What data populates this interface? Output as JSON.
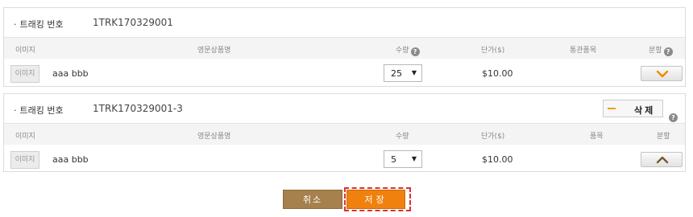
{
  "tracking_blocks": [
    {
      "label": "트래킹 번호",
      "bullet": "·",
      "number": "1TRK170329001",
      "columns": {
        "image": "이미지",
        "name": "영문상품명",
        "qty": "수량",
        "price": "단가($)",
        "category": "통관품목",
        "split": "분할"
      },
      "item": {
        "image_placeholder": "이미지",
        "name": "aaa bbb",
        "qty": "25",
        "price": "$10.00"
      },
      "split_icon": "chevron-down-icon"
    },
    {
      "label": "트래킹 번호",
      "bullet": "·",
      "number": "1TRK170329001-3",
      "delete_label": "삭제",
      "columns": {
        "image": "이미지",
        "name": "영문상품명",
        "qty": "수량",
        "price": "단가($)",
        "category": "품목",
        "split": "분할"
      },
      "item": {
        "image_placeholder": "이미지",
        "name": "aaa bbb",
        "qty": "5",
        "price": "$10.00"
      },
      "split_icon": "chevron-up-icon"
    }
  ],
  "help_glyph": "?",
  "select_arrow": "▼",
  "actions": {
    "cancel_label": "취소",
    "save_label": "저장"
  },
  "colors": {
    "accent_orange": "#f0810f",
    "cancel_brown": "#a6804d",
    "focus_dashed": "#e03030"
  }
}
